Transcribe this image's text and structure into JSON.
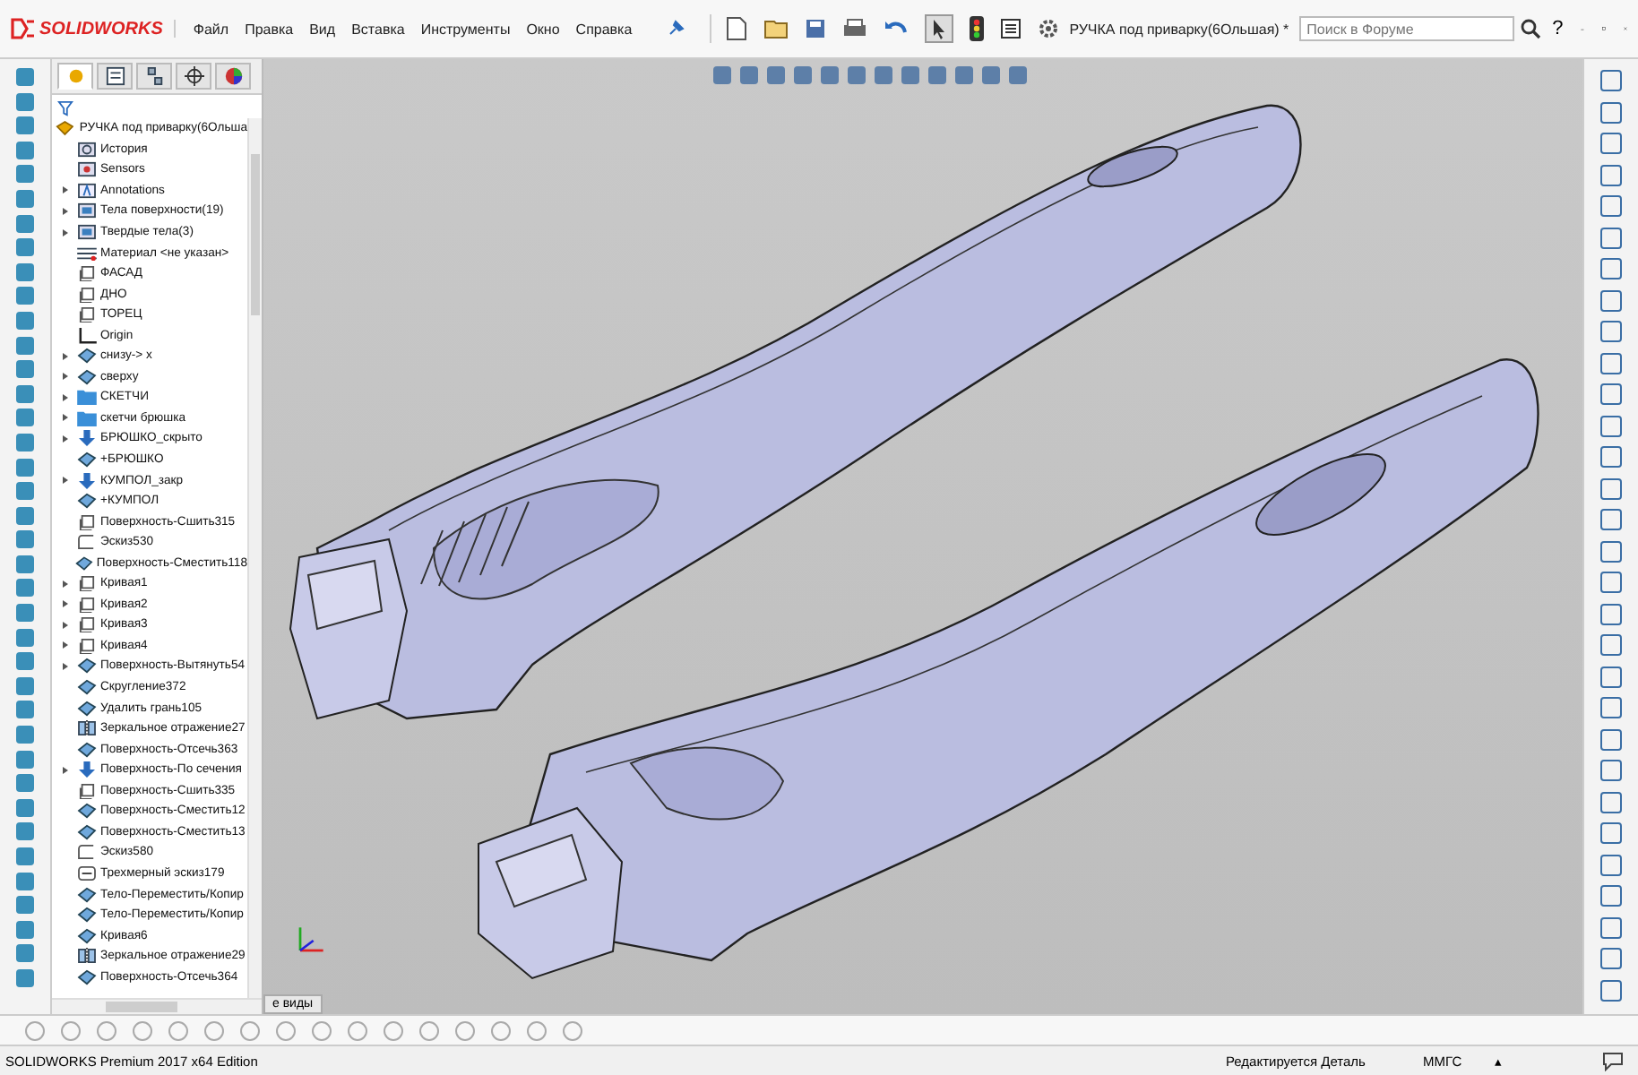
{
  "app": {
    "logo": "SOLIDWORKS",
    "title": "РУЧКА под приварку(6Ольшая) *",
    "help": "?"
  },
  "menu": [
    "Файл",
    "Правка",
    "Вид",
    "Вставка",
    "Инструменты",
    "Окно",
    "Справка"
  ],
  "search": {
    "placeholder": "Поиск в Форуме"
  },
  "panel_tabs": [
    {
      "kind": "feature",
      "selected": true
    },
    {
      "kind": "property",
      "selected": false
    },
    {
      "kind": "config",
      "selected": false
    },
    {
      "kind": "dim",
      "selected": false
    },
    {
      "kind": "display",
      "selected": false
    }
  ],
  "tree": {
    "root": "РУЧКА под приварку(6Ольша",
    "items": [
      {
        "label": "История",
        "kind": "history",
        "expandable": false
      },
      {
        "label": "Sensors",
        "kind": "sensor",
        "expandable": false
      },
      {
        "label": "Annotations",
        "kind": "annotation",
        "expandable": true
      },
      {
        "label": "Тела поверхности(19)",
        "kind": "bodies",
        "expandable": true
      },
      {
        "label": "Твердые тела(3)",
        "kind": "bodies",
        "expandable": true
      },
      {
        "label": "Материал <не указан>",
        "kind": "material",
        "expandable": false
      },
      {
        "label": "ФАСАД",
        "kind": "plane",
        "expandable": false
      },
      {
        "label": "ДНО",
        "kind": "plane",
        "expandable": false
      },
      {
        "label": "ТОРЕЦ",
        "kind": "plane",
        "expandable": false
      },
      {
        "label": "Origin",
        "kind": "origin",
        "expandable": false
      },
      {
        "label": "снизу-> х",
        "kind": "feature",
        "expandable": true
      },
      {
        "label": "сверху",
        "kind": "feature",
        "expandable": true
      },
      {
        "label": "СКЕТЧИ",
        "kind": "folder",
        "expandable": true
      },
      {
        "label": "скетчи брюшка",
        "kind": "folder",
        "expandable": true
      },
      {
        "label": "БРЮШКО_скрыто",
        "kind": "down",
        "expandable": true
      },
      {
        "label": "+БРЮШКО",
        "kind": "feature",
        "expandable": false
      },
      {
        "label": "КУМПОЛ_закр",
        "kind": "down",
        "expandable": true
      },
      {
        "label": "+КУМПОЛ",
        "kind": "feature",
        "expandable": false
      },
      {
        "label": "Поверхность-Сшить315",
        "kind": "plane",
        "expandable": false
      },
      {
        "label": "Эскиз530",
        "kind": "sketch",
        "expandable": false
      },
      {
        "label": "Поверхность-Сместить118",
        "kind": "feature",
        "expandable": false
      },
      {
        "label": "Кривая1",
        "kind": "plane",
        "expandable": true
      },
      {
        "label": "Кривая2",
        "kind": "plane",
        "expandable": true
      },
      {
        "label": "Кривая3",
        "kind": "plane",
        "expandable": true
      },
      {
        "label": "Кривая4",
        "kind": "plane",
        "expandable": true
      },
      {
        "label": "Поверхность-Вытянуть54",
        "kind": "feature",
        "expandable": true
      },
      {
        "label": "Скругление372",
        "kind": "feature",
        "expandable": false
      },
      {
        "label": "Удалить грань105",
        "kind": "feature",
        "expandable": false
      },
      {
        "label": "Зеркальное отражение27",
        "kind": "mirror",
        "expandable": false
      },
      {
        "label": "Поверхность-Отсечь363",
        "kind": "feature",
        "expandable": false
      },
      {
        "label": "Поверхность-По сечения",
        "kind": "down",
        "expandable": true
      },
      {
        "label": "Поверхность-Сшить335",
        "kind": "plane",
        "expandable": false
      },
      {
        "label": "Поверхность-Сместить12",
        "kind": "feature",
        "expandable": false
      },
      {
        "label": "Поверхность-Сместить13",
        "kind": "feature",
        "expandable": false
      },
      {
        "label": "Эскиз580",
        "kind": "sketch",
        "expandable": false
      },
      {
        "label": "Трехмерный эскиз179",
        "kind": "sketch3d",
        "expandable": false
      },
      {
        "label": "Тело-Переместить/Копир",
        "kind": "feature",
        "expandable": false
      },
      {
        "label": "Тело-Переместить/Копир",
        "kind": "feature",
        "expandable": false
      },
      {
        "label": "Кривая6",
        "kind": "feature",
        "expandable": false
      },
      {
        "label": "Зеркальное отражение29",
        "kind": "mirror",
        "expandable": false
      },
      {
        "label": "Поверхность-Отсечь364",
        "kind": "feature",
        "expandable": false
      }
    ]
  },
  "view_tab": "е виды",
  "status_bar": {
    "edition": "SOLIDWORKS Premium 2017 x64 Edition",
    "mode": "Редактируется Деталь",
    "units": "ММГС",
    "units_arrow": "▴"
  }
}
